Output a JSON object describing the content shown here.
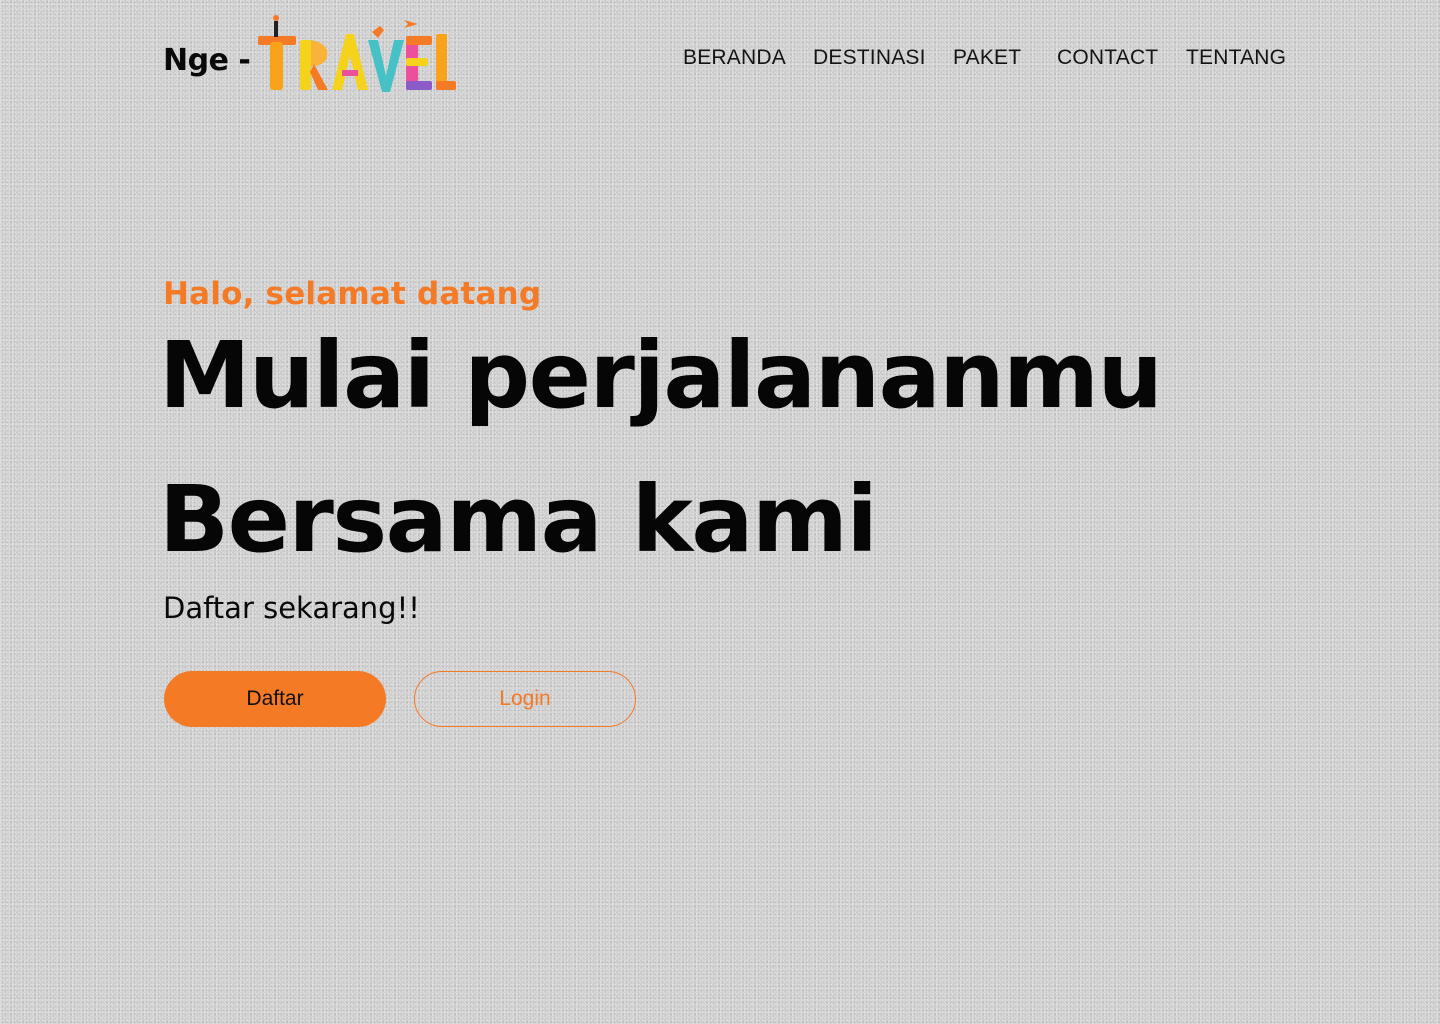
{
  "header": {
    "brand_text": "Nge -",
    "brand_logo_text": "TRAVEL",
    "nav": [
      {
        "label": "BERANDA"
      },
      {
        "label": "DESTINASI"
      },
      {
        "label": "PAKET"
      },
      {
        "label": "CONTACT"
      },
      {
        "label": "TENTANG"
      }
    ]
  },
  "hero": {
    "greeting": "Halo, selamat datang",
    "headline_line1": "Mulai perjalananmu",
    "headline_line2": "Bersama kami",
    "subline": "Daftar sekarang!!",
    "primary_button": "Daftar",
    "secondary_button": "Login"
  },
  "colors": {
    "accent": "#f47a26",
    "background": "#d2d2d2",
    "text": "#0a0a0a"
  }
}
